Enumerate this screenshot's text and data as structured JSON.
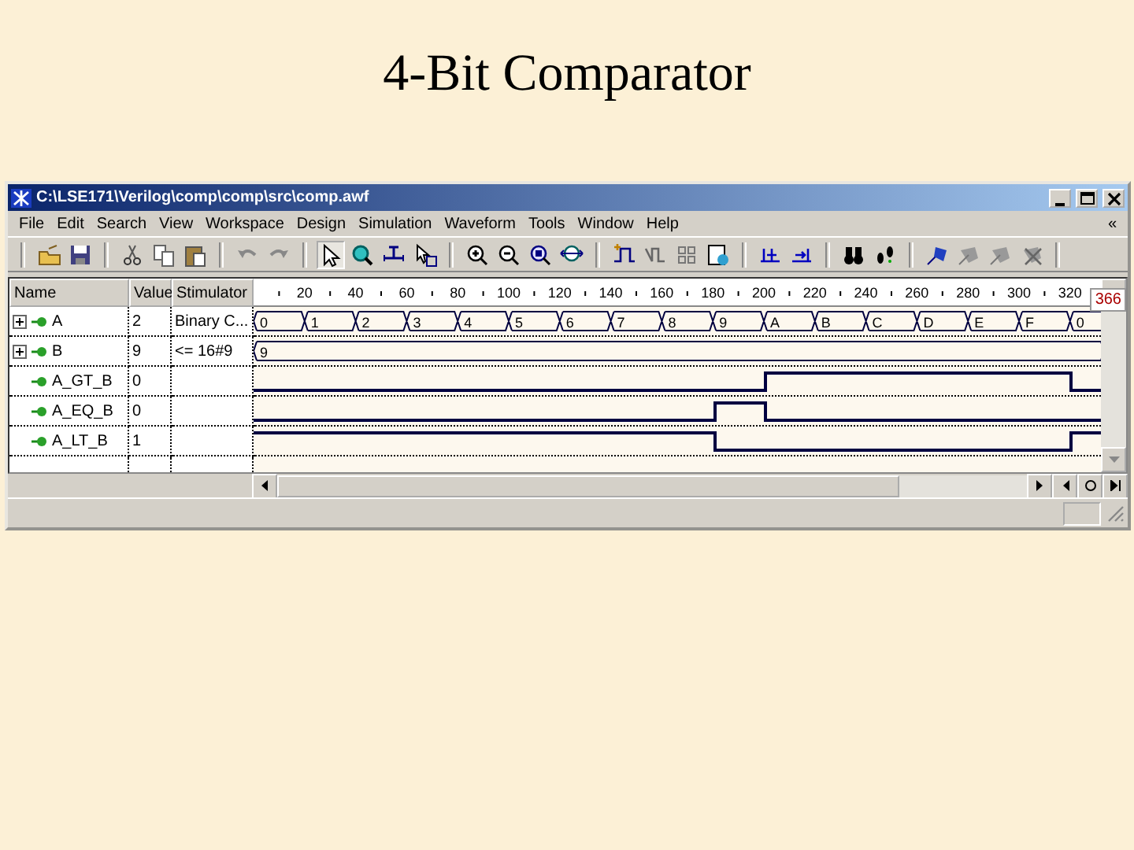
{
  "slide_title": "4-Bit Comparator",
  "window": {
    "title": "C:\\LSE171\\Verilog\\comp\\comp\\src\\comp.awf"
  },
  "menu": [
    "File",
    "Edit",
    "Search",
    "View",
    "Workspace",
    "Design",
    "Simulation",
    "Waveform",
    "Tools",
    "Window",
    "Help"
  ],
  "menu_chevron": "«",
  "columns": [
    "Name",
    "Value",
    "Stimulator"
  ],
  "ruler_ticks": [
    "20",
    "40",
    "60",
    "80",
    "100",
    "120",
    "140",
    "160",
    "180",
    "200",
    "220",
    "240",
    "260",
    "280",
    "300",
    "320"
  ],
  "cursor_time": "366",
  "signals": [
    {
      "name": "A",
      "kind": "bus",
      "expanded": false,
      "value": "2",
      "stimulator": "Binary C...",
      "segments": [
        "0",
        "1",
        "2",
        "3",
        "4",
        "5",
        "6",
        "7",
        "8",
        "9",
        "A",
        "B",
        "C",
        "D",
        "E",
        "F",
        "0"
      ]
    },
    {
      "name": "B",
      "kind": "bus",
      "expanded": false,
      "value": "9",
      "stimulator": "<= 16#9",
      "segments": [
        "9"
      ]
    },
    {
      "name": "A_GT_B",
      "kind": "bit",
      "value": "0",
      "steps": [
        {
          "high": false
        },
        {
          "high": false
        },
        {
          "high": false
        },
        {
          "high": false
        },
        {
          "high": false
        },
        {
          "high": false
        },
        {
          "high": false
        },
        {
          "high": false
        },
        {
          "high": false
        },
        {
          "high": false
        },
        {
          "high": true
        },
        {
          "high": true
        },
        {
          "high": true
        },
        {
          "high": true
        },
        {
          "high": true
        },
        {
          "high": true
        },
        {
          "high": false
        }
      ]
    },
    {
      "name": "A_EQ_B",
      "kind": "bit",
      "value": "0",
      "steps": [
        {
          "high": false
        },
        {
          "high": false
        },
        {
          "high": false
        },
        {
          "high": false
        },
        {
          "high": false
        },
        {
          "high": false
        },
        {
          "high": false
        },
        {
          "high": false
        },
        {
          "high": false
        },
        {
          "high": true
        },
        {
          "high": false
        },
        {
          "high": false
        },
        {
          "high": false
        },
        {
          "high": false
        },
        {
          "high": false
        },
        {
          "high": false
        },
        {
          "high": false
        }
      ]
    },
    {
      "name": "A_LT_B",
      "kind": "bit",
      "value": "1",
      "steps": [
        {
          "high": true
        },
        {
          "high": true
        },
        {
          "high": true
        },
        {
          "high": true
        },
        {
          "high": true
        },
        {
          "high": true
        },
        {
          "high": true
        },
        {
          "high": true
        },
        {
          "high": true
        },
        {
          "high": false
        },
        {
          "high": false
        },
        {
          "high": false
        },
        {
          "high": false
        },
        {
          "high": false
        },
        {
          "high": false
        },
        {
          "high": false
        },
        {
          "high": true
        }
      ]
    }
  ]
}
